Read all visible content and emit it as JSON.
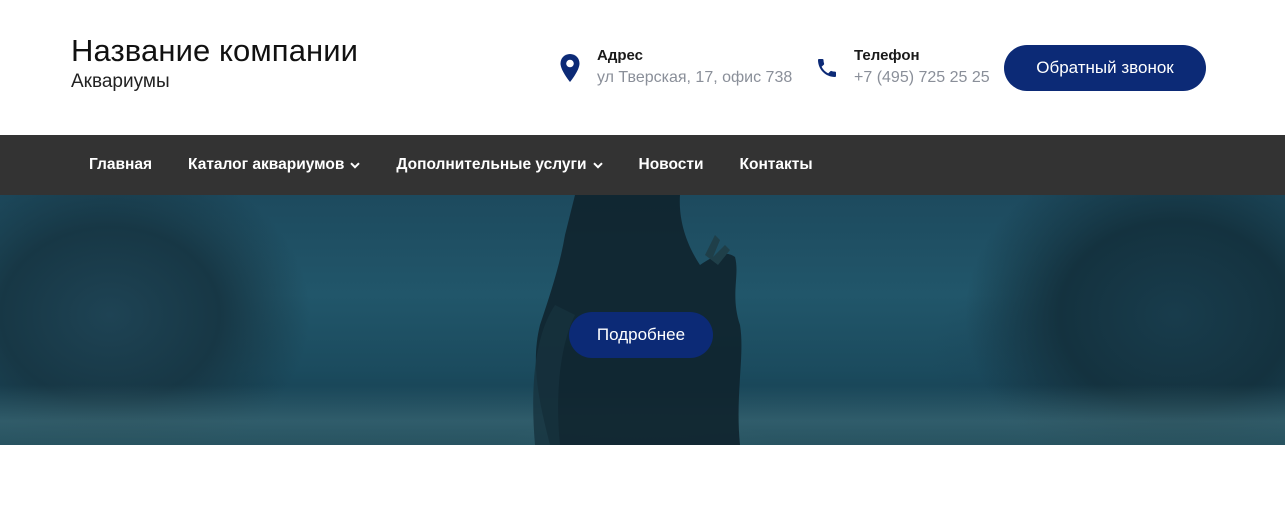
{
  "header": {
    "company_name": "Название компании",
    "company_tagline": "Аквариумы",
    "address": {
      "label": "Адрес",
      "value": "ул Тверская, 17, офис 738",
      "icon": "map-pin-icon"
    },
    "phone": {
      "label": "Телефон",
      "value": "+7 (495) 725 25 25",
      "icon": "phone-icon"
    },
    "callback_button": "Обратный звонок"
  },
  "nav": {
    "items": [
      {
        "label": "Главная",
        "has_dropdown": false
      },
      {
        "label": "Каталог аквариумов",
        "has_dropdown": true
      },
      {
        "label": "Дополнительные услуги",
        "has_dropdown": true
      },
      {
        "label": "Новости",
        "has_dropdown": false
      },
      {
        "label": "Контакты",
        "has_dropdown": false
      }
    ]
  },
  "hero": {
    "button_label": "Подробнее"
  },
  "colors": {
    "accent": "#0c2a76",
    "nav_background": "#333333",
    "muted_text": "#8a8f99"
  }
}
